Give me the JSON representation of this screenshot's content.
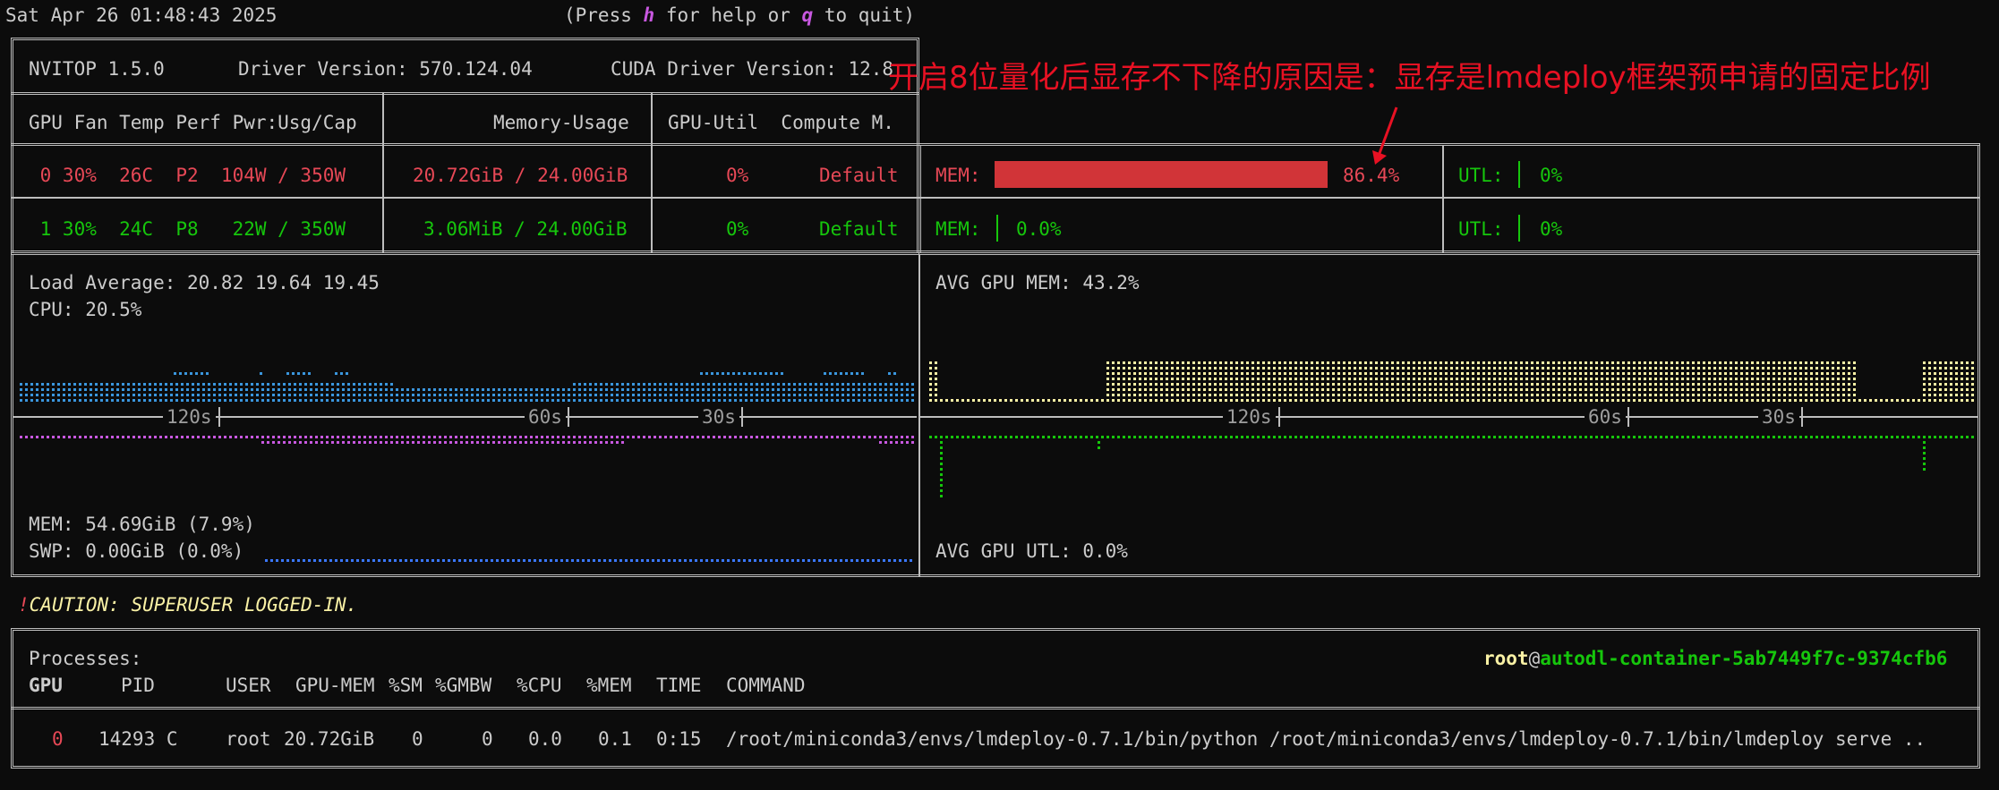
{
  "header": {
    "datetime": "Sat Apr 26 01:48:43 2025",
    "help_prefix": "(Press ",
    "help_key": "h",
    "help_mid": " for help or ",
    "quit_key": "q",
    "help_suffix": " to quit)"
  },
  "gpu_panel": {
    "nvitop": "NVITOP 1.5.0",
    "driver": "Driver Version: 570.124.04",
    "cuda": "CUDA Driver Version: 12.8",
    "col1": "GPU Fan Temp Perf Pwr:Usg/Cap",
    "col2": "Memory-Usage",
    "col3": "GPU-Util  Compute M.",
    "gpus": [
      {
        "row": " 0 30%  26C  P2  104W / 350W",
        "mem": "20.72GiB / 24.00GiB",
        "util": "0%",
        "compute": "Default",
        "mem_label": "MEM:",
        "mem_pct": "86.4%",
        "mem_frac": 0.864,
        "utl_label": "UTL:",
        "utl": "0%"
      },
      {
        "row": " 1 30%  24C  P8   22W / 350W",
        "mem": "3.06MiB / 24.00GiB",
        "util": "0%",
        "compute": "Default",
        "mem_label": "MEM:",
        "mem_pct": "0.0%",
        "mem_frac": 0.0,
        "utl_label": "UTL:",
        "utl": "0%"
      }
    ]
  },
  "host": {
    "load": "Load Average: 20.82 19.64 19.45",
    "cpu": "CPU: 20.5%",
    "mem": "MEM: 54.69GiB (7.9%)",
    "swp": "SWP: 0.00GiB (0.0%)",
    "avg_gpu_mem": "AVG GPU MEM: 43.2%",
    "avg_gpu_utl": "AVG GPU UTL: 0.0%",
    "axis": [
      "120s",
      "60s",
      "30s"
    ]
  },
  "caution": {
    "mark": "!",
    "text": "CAUTION: SUPERUSER LOGGED-IN."
  },
  "processes": {
    "title": "Processes:",
    "user": "root",
    "at": "@",
    "host": "autodl-container-5ab7449f7c-9374cfb6",
    "headers": [
      "GPU",
      "PID",
      "USER",
      "GPU-MEM",
      "%SM",
      "%GMBW",
      "%CPU",
      "%MEM",
      "TIME",
      "COMMAND"
    ],
    "rows": [
      {
        "gpu": "0",
        "pid": "14293 C",
        "user": "root",
        "gpu_mem": "20.72GiB",
        "sm": "0",
        "gmbw": "0",
        "cpu": "0.0",
        "mem": "0.1",
        "time": "0:15",
        "command": "/root/miniconda3/envs/lmdeploy-0.7.1/bin/python /root/miniconda3/envs/lmdeploy-0.7.1/bin/lmdeploy serve .."
      }
    ]
  },
  "annotation": {
    "text": "开启8位量化后显存不下降的原因是：显存是lmdeploy框架预申请的固定比例"
  },
  "colors": {
    "background": "#0c0c0c",
    "red": "#e74856",
    "green": "#16c60c",
    "cyan": "#3a96dd",
    "magenta": "#c858e0",
    "yellow": "#f9f1a5",
    "annotation": "#e81123"
  }
}
